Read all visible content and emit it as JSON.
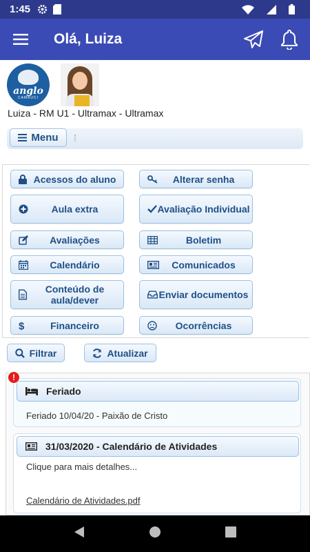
{
  "status_bar": {
    "time": "1:45"
  },
  "app_bar": {
    "title": "Olá, Luiza"
  },
  "profile": {
    "logo_text": "anglo",
    "logo_subtext": "CAMBUCI",
    "student_info": "Luiza - RM U1 - Ultramax - Ultramax"
  },
  "menu": {
    "label": "Menu"
  },
  "actions": {
    "acessos": "Acessos do aluno",
    "alterar_senha": "Alterar senha",
    "aula_extra": "Aula extra",
    "avaliacao_individual": "Avaliação Individual",
    "avaliacoes": "Avaliações",
    "boletim": "Boletim",
    "calendario": "Calendário",
    "comunicados": "Comunicados",
    "conteudo": "Conteúdo de aula/dever",
    "enviar_documentos": "Enviar documentos",
    "financeiro": "Financeiro",
    "ocorrencias": "Ocorrências"
  },
  "toolbar": {
    "filtrar": "Filtrar",
    "atualizar": "Atualizar"
  },
  "feed": {
    "alert_badge": "!",
    "items": [
      {
        "title": "Feriado",
        "text": "Feriado 10/04/20 - Paixão de Cristo"
      },
      {
        "title": "31/03/2020 - Calendário de Atividades",
        "text": "Clique para mais detalhes...",
        "attachment": "Calendário de Atividades.pdf"
      }
    ]
  },
  "colors": {
    "status_bar": "#2d3a8c",
    "app_bar": "#3b4bb5",
    "button_text": "#1f4f86",
    "button_border": "#9cc0e3",
    "alert": "#e41b1b"
  }
}
